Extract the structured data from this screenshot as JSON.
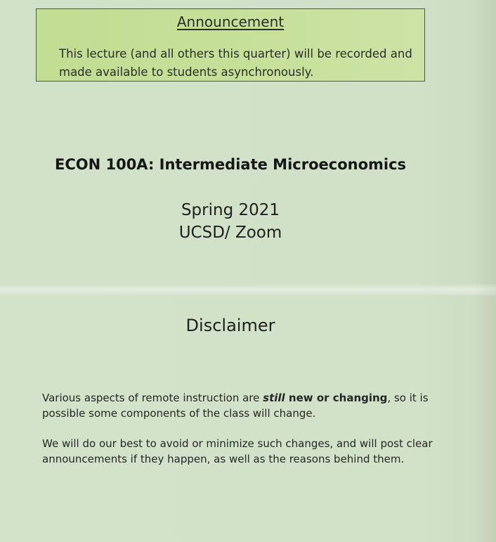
{
  "announcement": {
    "title": "Announcement",
    "body": "This lecture (and all others this quarter) will be recorded and made available to students asynchronously."
  },
  "course": {
    "title": "ECON 100A: Intermediate Microeconomics",
    "term": "Spring 2021",
    "location": "UCSD/ Zoom"
  },
  "disclaimer": {
    "title": "Disclaimer",
    "paragraph1": {
      "before": "Various aspects of remote instruction are ",
      "emphasis_italic": "still",
      "emphasis_bold": " new or changing",
      "after": ", so it is possible some components of the class will change."
    },
    "paragraph2": "We will do our best to avoid or minimize such changes, and will post clear announcements if they happen, as well as the reasons behind them."
  }
}
